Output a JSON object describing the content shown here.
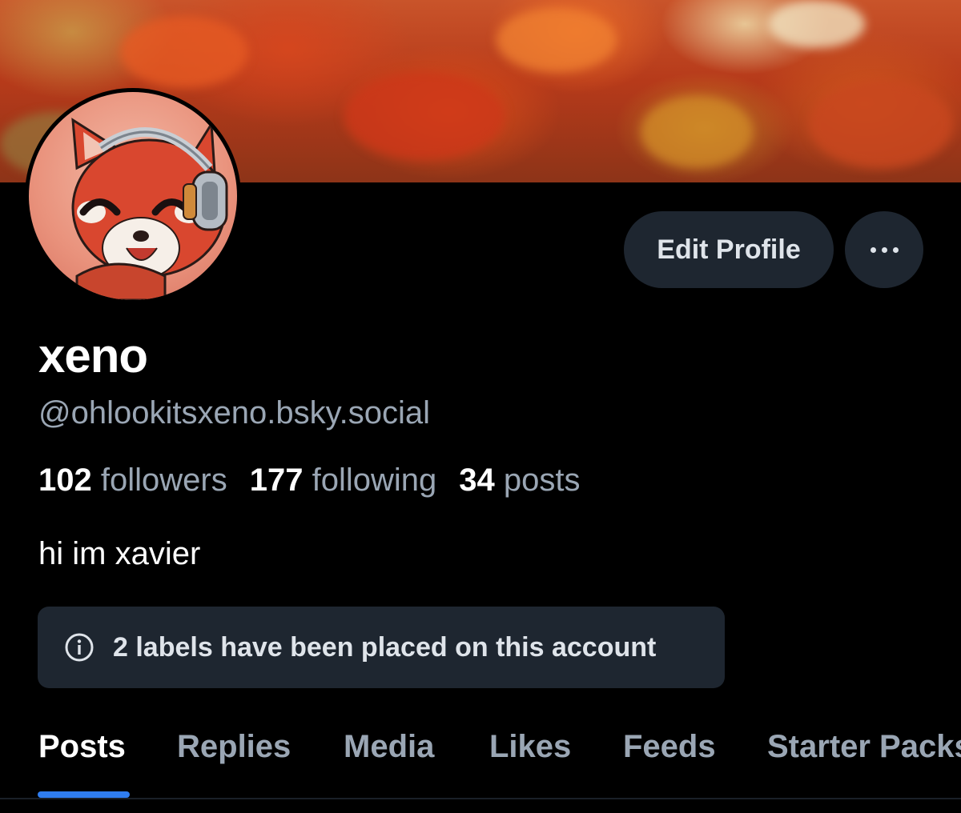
{
  "profile": {
    "display_name": "xeno",
    "handle": "@ohlookitsxeno.bsky.social",
    "bio": "hi im xavier",
    "avatar_icon": "red-panda-avatar-with-headphones",
    "banner": "autumn-red-leaves-banner"
  },
  "actions": {
    "edit_profile_label": "Edit Profile",
    "more_icon": "ellipsis-icon"
  },
  "stats": {
    "followers_count": "102",
    "followers_label": "followers",
    "following_count": "177",
    "following_label": "following",
    "posts_count": "34",
    "posts_label": "posts"
  },
  "labels_notice": {
    "icon": "info-icon",
    "text": "2 labels have been placed on this account"
  },
  "tabs": [
    {
      "label": "Posts",
      "active": true
    },
    {
      "label": "Replies",
      "active": false
    },
    {
      "label": "Media",
      "active": false
    },
    {
      "label": "Likes",
      "active": false
    },
    {
      "label": "Feeds",
      "active": false
    },
    {
      "label": "Starter Packs",
      "active": false
    }
  ],
  "colors": {
    "background": "#000000",
    "surface": "#1e2630",
    "muted_text": "#9aa6b4",
    "accent": "#2f7df0"
  }
}
